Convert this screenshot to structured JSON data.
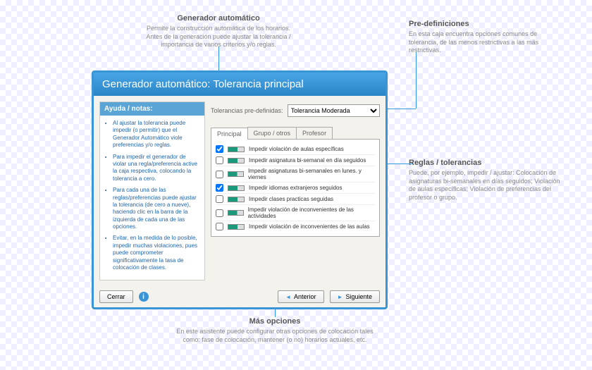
{
  "callouts": {
    "top_left": {
      "title": "Generador automático",
      "text": "Permite la construcción automática de los horarios. Antes de la generación puede ajustar la tolerancia / importancia de varios criterios y/o reglas."
    },
    "top_right": {
      "title": "Pre-definiciones",
      "text": "En esta caja encuentra opciones comunes de tolerancia, de las menos restrictivas a las más restrictivas."
    },
    "right": {
      "title": "Reglas / tolerancias",
      "text": "Puede, por ejemplo, impedir / ajustar: Colocación de asignaturas bi-semanales en días seguidos; Violación de aulas específicas; Violación de preferencias del profesor o grupo."
    },
    "bottom": {
      "title": "Más opciones",
      "text": "En este asistente puede configurar otras opciones de colocación tales como: fase de colocación, mantener (o no) horarios actuales, etc."
    }
  },
  "dialog": {
    "title": "Generador automático: Tolerancia principal",
    "help_header": "Ayuda / notas:",
    "help_items": [
      "Al ajustar la tolerancia puede impedir (o permitir) que el Generador Automático viole preferencias y/o reglas.",
      "Para impedir el generador de violar una regla/preferencia active la caja respectiva, colocando la tolerancia a cero.",
      "Para cada una de las reglas/preferencias puede ajustar la tolerancia (de cero a nueve), haciendo clic en la barra de la izquierda de cada una de las opciones.",
      "Evitar, en la medida de lo posible, impedir muchas violaciones, pues puede comprometer significativamente la tasa de colocación de clases."
    ],
    "predef_label": "Tolerancias pre-definidas:",
    "predef_selected": "Tolerancia Moderada",
    "tabs": [
      "Principal",
      "Grupo / otros",
      "Profesor"
    ],
    "rules": [
      {
        "checked": true,
        "label": "Impedir violación de aulas específicas"
      },
      {
        "checked": false,
        "label": "Impedir asignatura bi-semanal en día seguidos"
      },
      {
        "checked": false,
        "label": "Impedir asignaturas bi-semanales en lunes. y viernes"
      },
      {
        "checked": true,
        "label": "Impedir idiomas extranjeros seguidos"
      },
      {
        "checked": false,
        "label": "Impedir clases practicas seguidas"
      },
      {
        "checked": false,
        "label": "Impedir violación de inconvenientes de las actividades"
      },
      {
        "checked": false,
        "label": "Impedir violación de inconvenientes de las aulas"
      }
    ],
    "buttons": {
      "close": "Cerrar",
      "prev": "Anterior",
      "next": "Siguiente"
    }
  }
}
